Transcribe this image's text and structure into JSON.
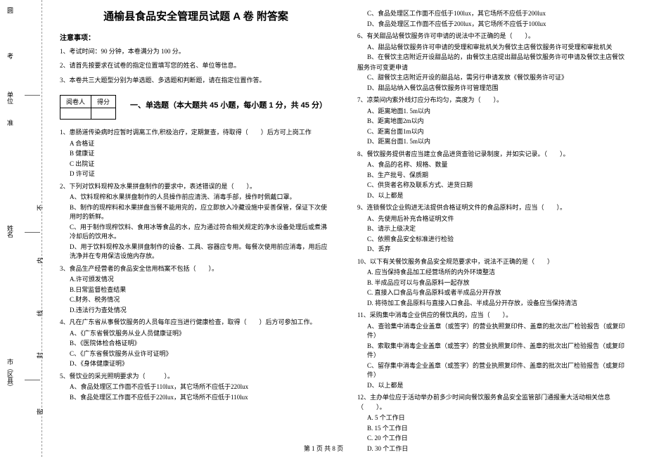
{
  "binding": {
    "label_top": "圆",
    "label_school": "考",
    "label_unit": "单位",
    "label_admit": "准",
    "label_name": "姓名",
    "label_city": "市（区县）",
    "seal1": "封",
    "seal2": "内",
    "seal3": "线",
    "seal4": "密",
    "seal5": "不"
  },
  "title": "通榆县食品安全管理员试题 A 卷 附答案",
  "notice_header": "注意事项：",
  "notices": [
    "1、考试时间：90 分钟，本卷满分为 100 分。",
    "2、请首先按要求在试卷的指定位置填写您的姓名、单位等信息。",
    "3、本卷共三大题型分别为单选题、多选题和判断题，请在指定位置作答。"
  ],
  "scoretable": {
    "h1": "阅卷人",
    "h2": "得分"
  },
  "part1_title": "一、单选题（本大题共 45 小题，每小题 1 分，共 45 分）",
  "left_questions": [
    {
      "q": "1、患肠道传染病时应暂时调离工作,积极治疗，定期复查，待取得（　　）后方可上岗工作",
      "opts": [
        "A 合格证",
        "B 健康证",
        "C 出院证",
        "D 许可证"
      ]
    },
    {
      "q": "2、下列对饮料现榨及水果拼盘制作的要求中，表述错误的是（　　）。",
      "opts": [
        "A、饮料现榨和水果拼盘制作的人员操作前应清洗、消毒手部，操作时佩戴口罩。",
        "B、制作的现榨料和水果拼盘当餐不能用完的，应立即放入冷藏设施中妥善保管，保证下次使用时的新鲜。",
        "C、用于制作现榨饮料、食用冰等食品的水，应为通过符合相关规定的净水设备处理后或煮沸冷却后的饮用水。",
        "D、用于饮料现榨及水果拼盘制作的设备、工具、容器应专用。每餐次使用前应消毒，用后应洗净并在专用保洁设施内存放。"
      ]
    },
    {
      "q": "3、食品生产经营者的食品安全信用档案不包括（　　）。",
      "opts": [
        "A.许可颁发情况",
        "B.日常监督检查结果",
        "C.财务、税务情况",
        "D.违法行为查处情况"
      ]
    },
    {
      "q": "4、凡在广东省从事餐饮服务的人员每年应当进行健康检查，取得（　　）后方可参加工作。",
      "opts": [
        "A、《广东省餐饮服务从业人员健康证明》",
        "B、《医院体检合格证明》",
        "C、《广东省餐饮服务从业许可证明》",
        "D、《身体健康证明》"
      ]
    },
    {
      "q": "5、餐饮业的采光照明要求为（　　　）。",
      "opts": [
        "A、食品处理区工作面不应低于110lux，其它场所不应低于220lux",
        "B、食品处理区工作面不应低于220lux，其它场所不应低于110lux"
      ]
    }
  ],
  "right_top_opts": [
    "C、食品处理区工作面不应低于100lux，其它场所不应低于200lux",
    "D、食品处理区工作面不应低于200lux，其它场所不应低于100lux"
  ],
  "right_questions": [
    {
      "q": "6、有关甜品站餐饮服务许可申请的说法中不正确的是（　　）。",
      "opts": [
        "A、甜品站餐饮服务许可申请的受理和审批机关为餐饮主店餐饮服务许可受理和审批机关",
        "B、在餐饮主店附近开设甜品站的，由餐饮主店提出甜品站餐饮服务许可申请及餐饮主店餐饮"
      ],
      "cont": "服务许可变更申请",
      "opts2": [
        "C、甜餐饮主店附近开设的甜品站，需另行申请发放《餐饮服务许可证》",
        "D、甜品站纳入餐饮品店餐饮服务许可管理范围"
      ]
    },
    {
      "q": "7、凉菜间内紫外线灯应分布均匀，高度为（　　）。",
      "opts": [
        "A、距离地面1. 5m以内",
        "B、距离地面2m以内",
        "C、距离台面1m以内",
        "D、距离台面1. 5m以内"
      ]
    },
    {
      "q": "8、餐饮服务提供者应当建立食品进货查验记录制度，并如实记录。（　　）。",
      "opts": [
        "A、食品的名称、规格、数量",
        "B、生产批号、保质期",
        "C、供货者名称及联系方式、进货日期",
        "D、以上都是"
      ]
    },
    {
      "q": "9、连锁餐饮企业购进无法提供合格证明文件的食品原料时，应当（　　）。",
      "opts": [
        "A、先使用后补充合格证明文件",
        "B、请示上级决定",
        "C、依照食品安全标准进行检验",
        "D、丢弃"
      ]
    },
    {
      "q": "10、以下有关餐饮服务食品安全规范要求中，说法不正确的是（　　）",
      "opts": [
        "A. 应当保持食品加工经营场所的内外环境整洁",
        "B. 半成品应可以与食品原料一起存放",
        "C. 直接入口食品与食品原料或者半成品分开存放",
        "D. 将待加工食品原料与直接入口食品、半成品分开存放，设备应当保持清洁"
      ]
    },
    {
      "q": "11、采购集中消毒企业供应的餐饮具的，应当（　　）。",
      "opts": [
        "A、查验集中消毒企业盖章（或签字）的营业执照复印件、盖章的批次出厂检验报告（或复印件）",
        "B、索取集中消毒企业盖章（或签字）的营业执照复印件、盖章的批次出厂检验报告（或复印件）",
        "C、留存集中消毒企业盖章（或签字）的营业执照复印件、盖章的批次出厂检验报告（或复印件）",
        "D、以上都是"
      ]
    },
    {
      "q": "12、主办单位应于活动举办前多少时间向餐饮服务食品安全监管部门通报重大活动相关信息（　　）。",
      "opts": [
        "A. 5 个工作日",
        "B. 15 个工作日",
        "C. 20 个工作日",
        "D. 30 个工作日"
      ]
    }
  ],
  "footer": "第 1 页 共 8 页"
}
